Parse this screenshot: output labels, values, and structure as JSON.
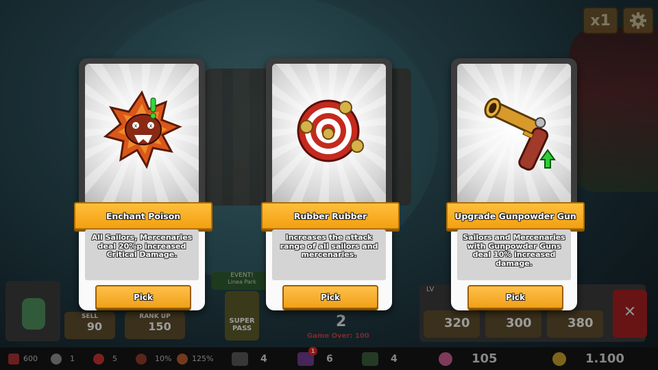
{
  "speed_label": "x1",
  "cards": [
    {
      "title": "Enchant Poison",
      "description": "All Sailors, Mercenaries deal 20%p increased Critical Damage.",
      "pick_label": "Pick",
      "icon": "poison-burst-icon"
    },
    {
      "title": "Rubber Rubber",
      "description": "Increases the attack range of all sailors and mercenaries.",
      "pick_label": "Pick",
      "icon": "target-icon"
    },
    {
      "title": "Upgrade Gunpowder Gun",
      "description": "Sailors and Mercenaries with Gunpowder Guns deal 10% increased damage.",
      "pick_label": "Pick",
      "icon": "gunpowder-gun-icon"
    }
  ],
  "hud": {
    "sell_label": "SELL",
    "sell_cost": "90",
    "rankup_label": "RANK UP",
    "rankup_cost": "150",
    "event_label": "EVENT!",
    "event_sub": "Linea Park",
    "super_pass_label": "SUPER PASS",
    "wave_number": "2",
    "game_over_text": "Game Over: 100",
    "lv_label": "LV",
    "shop_costs": [
      "320",
      "300",
      "380"
    ],
    "close_label": "✕"
  },
  "resources": {
    "hp": "600",
    "cannon": "1",
    "target": "5",
    "crit": "10%",
    "crit_damage": "125%",
    "unit_a": "4",
    "unit_b": "6",
    "unit_b_badge": "1",
    "unit_c": "4",
    "gems": "105",
    "gold": "1.100"
  },
  "colors": {
    "banner": "#f2a012",
    "pick_button": "#f0a018",
    "card_frame": "#3c3c3c"
  }
}
